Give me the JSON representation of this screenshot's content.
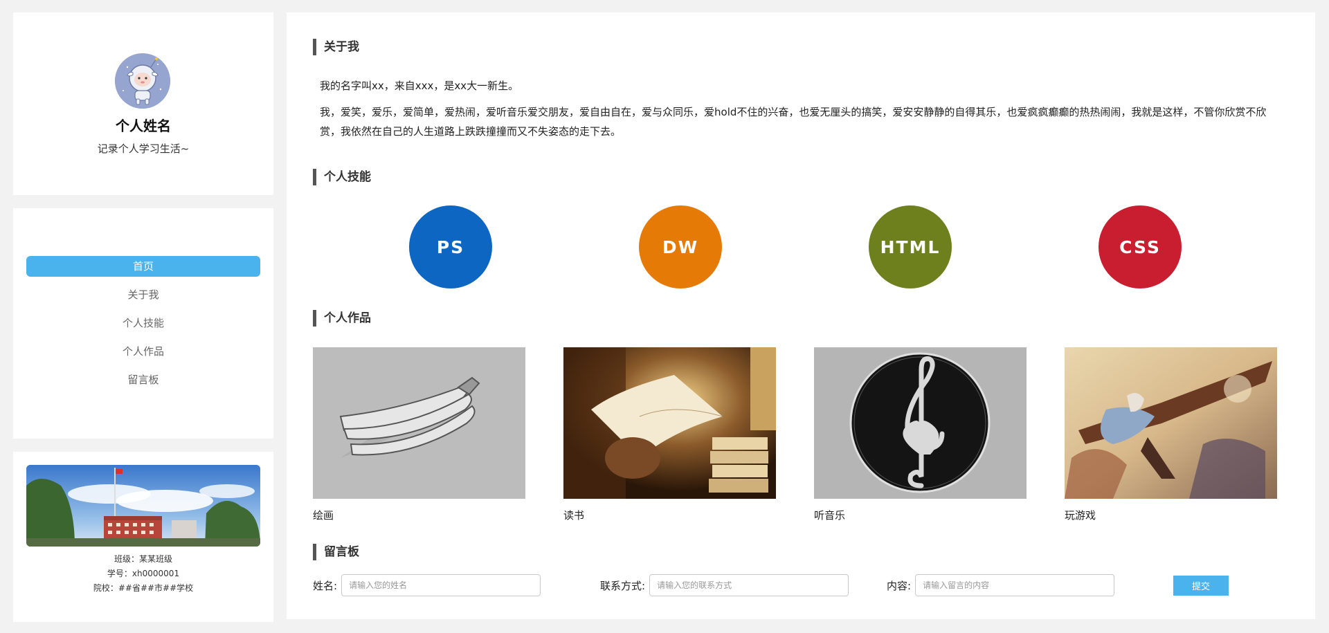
{
  "profile": {
    "name": "个人姓名",
    "description": "记录个人学习生活~",
    "avatar_icon": "sheep-astronaut-icon"
  },
  "nav": {
    "items": [
      {
        "label": "首页",
        "active": true
      },
      {
        "label": "关于我",
        "active": false
      },
      {
        "label": "个人技能",
        "active": false
      },
      {
        "label": "个人作品",
        "active": false
      },
      {
        "label": "留言板",
        "active": false
      }
    ]
  },
  "school": {
    "class_line": "班级：某某班级",
    "id_line": "学号：xh0000001",
    "school_line": "院校：##省##市##学校"
  },
  "about": {
    "title": "关于我",
    "paragraph1": "我的名字叫xx，来自xxx，是xx大一新生。",
    "paragraph2": "我，爱笑，爱乐，爱简单，爱热闹，爱听音乐爱交朋友，爱自由自在，爱与众同乐，爱hold不住的兴奋，也爱无厘头的搞笑，爱安安静静的自得其乐，也爱疯疯癫癫的热热闹闹，我就是这样，不管你欣赏不欣赏，我依然在自己的人生道路上跌跌撞撞而又不失姿态的走下去。"
  },
  "skills": {
    "title": "个人技能",
    "items": [
      {
        "label": "PS",
        "color": "#0d67c2"
      },
      {
        "label": "DW",
        "color": "#e67a06"
      },
      {
        "label": "HTML",
        "color": "#6e801e"
      },
      {
        "label": "CSS",
        "color": "#c91e30"
      }
    ]
  },
  "works": {
    "title": "个人作品",
    "items": [
      {
        "label": "绘画",
        "icon": "banana-sketch-image"
      },
      {
        "label": "读书",
        "icon": "reading-book-image"
      },
      {
        "label": "听音乐",
        "icon": "treble-clef-heart-image"
      },
      {
        "label": "玩游戏",
        "icon": "game-art-image"
      }
    ]
  },
  "guestbook": {
    "title": "留言板",
    "name_label": "姓名:",
    "name_placeholder": "请输入您的姓名",
    "contact_label": "联系方式:",
    "contact_placeholder": "请输入您的联系方式",
    "content_label": "内容:",
    "content_placeholder": "请输入留言的内容",
    "submit_label": "提交"
  },
  "colors": {
    "accent": "#4ab3ee",
    "background": "#f2f2f2"
  }
}
